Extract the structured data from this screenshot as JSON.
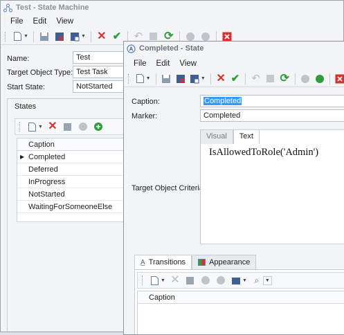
{
  "main_window": {
    "title": "Test - State Machine",
    "menu": [
      "File",
      "Edit",
      "View"
    ],
    "fields": {
      "name_label": "Name:",
      "name_value": "Test",
      "target_type_label": "Target Object Type:",
      "target_type_value": "Test Task",
      "start_state_label": "Start State:",
      "start_state_value": "NotStarted"
    },
    "states_group_title": "States",
    "states_grid": {
      "header": "Caption",
      "rows": [
        "Completed",
        "Deferred",
        "InProgress",
        "NotStarted",
        "WaitingForSomeoneElse"
      ]
    }
  },
  "state_window": {
    "title": "Completed - State",
    "menu": [
      "File",
      "Edit",
      "View"
    ],
    "fields": {
      "caption_label": "Caption:",
      "caption_value": "Completed",
      "marker_label": "Marker:",
      "marker_value": "Completed",
      "criteria_label": "Target Object Criteria:"
    },
    "criteria_tabs": [
      "Visual",
      "Text"
    ],
    "criteria_text": "IsAllowedToRole('Admin')",
    "bottom_tabs": [
      "Transitions",
      "Appearance"
    ],
    "transitions_grid_header": "Caption"
  },
  "colors": {
    "accent_red": "#d9302b",
    "accent_green": "#2e9e3a",
    "selection_blue": "#3399ff"
  }
}
